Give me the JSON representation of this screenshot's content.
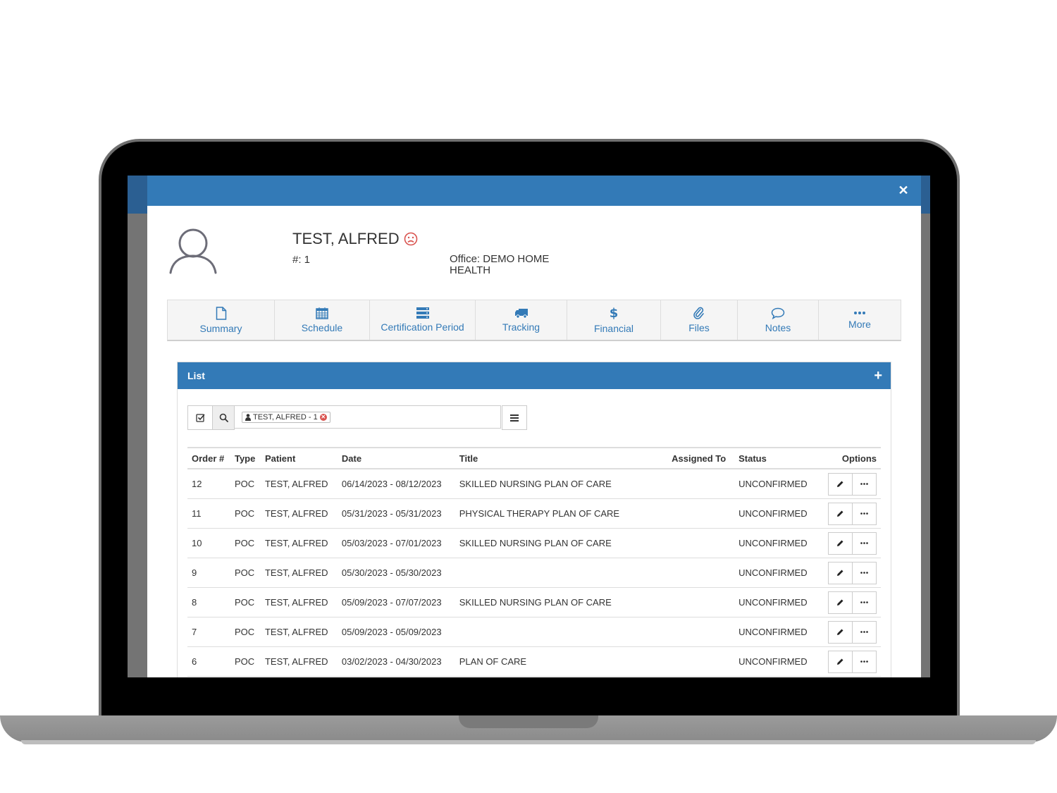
{
  "patient": {
    "name": "TEST, ALFRED",
    "number": "#: 1",
    "office": "Office: DEMO HOME HEALTH"
  },
  "tabs": [
    {
      "label": "Summary",
      "icon": "file-icon"
    },
    {
      "label": "Schedule",
      "icon": "calendar-icon"
    },
    {
      "label": "Certification Period",
      "icon": "server-icon"
    },
    {
      "label": "Tracking",
      "icon": "truck-icon"
    },
    {
      "label": "Financial",
      "icon": "dollar-icon"
    },
    {
      "label": "Files",
      "icon": "paperclip-icon"
    },
    {
      "label": "Notes",
      "icon": "comment-icon"
    },
    {
      "label": "More",
      "icon": "ellipsis-icon"
    }
  ],
  "panel": {
    "title": "List",
    "add_symbol": "+"
  },
  "filter": {
    "tag": "TEST, ALFRED - 1"
  },
  "table": {
    "headers": [
      "Order #",
      "Type",
      "Patient",
      "Date",
      "Title",
      "Assigned To",
      "Status",
      "Options"
    ],
    "rows": [
      {
        "order": "12",
        "type": "POC",
        "patient": "TEST, ALFRED",
        "date": "06/14/2023 - 08/12/2023",
        "title": "SKILLED NURSING PLAN OF CARE",
        "assigned": "",
        "status": "UNCONFIRMED"
      },
      {
        "order": "11",
        "type": "POC",
        "patient": "TEST, ALFRED",
        "date": "05/31/2023 - 05/31/2023",
        "title": "PHYSICAL THERAPY PLAN OF CARE",
        "assigned": "",
        "status": "UNCONFIRMED"
      },
      {
        "order": "10",
        "type": "POC",
        "patient": "TEST, ALFRED",
        "date": "05/03/2023 - 07/01/2023",
        "title": "SKILLED NURSING PLAN OF CARE",
        "assigned": "",
        "status": "UNCONFIRMED"
      },
      {
        "order": "9",
        "type": "POC",
        "patient": "TEST, ALFRED",
        "date": "05/30/2023 - 05/30/2023",
        "title": "",
        "assigned": "",
        "status": "UNCONFIRMED"
      },
      {
        "order": "8",
        "type": "POC",
        "patient": "TEST, ALFRED",
        "date": "05/09/2023 - 07/07/2023",
        "title": "SKILLED NURSING PLAN OF CARE",
        "assigned": "",
        "status": "UNCONFIRMED"
      },
      {
        "order": "7",
        "type": "POC",
        "patient": "TEST, ALFRED",
        "date": "05/09/2023 - 05/09/2023",
        "title": "",
        "assigned": "",
        "status": "UNCONFIRMED"
      },
      {
        "order": "6",
        "type": "POC",
        "patient": "TEST, ALFRED",
        "date": "03/02/2023 - 04/30/2023",
        "title": "PLAN OF CARE",
        "assigned": "",
        "status": "UNCONFIRMED"
      }
    ]
  },
  "colors": {
    "primary": "#337ab7",
    "warning_icon": "#d9534f"
  }
}
